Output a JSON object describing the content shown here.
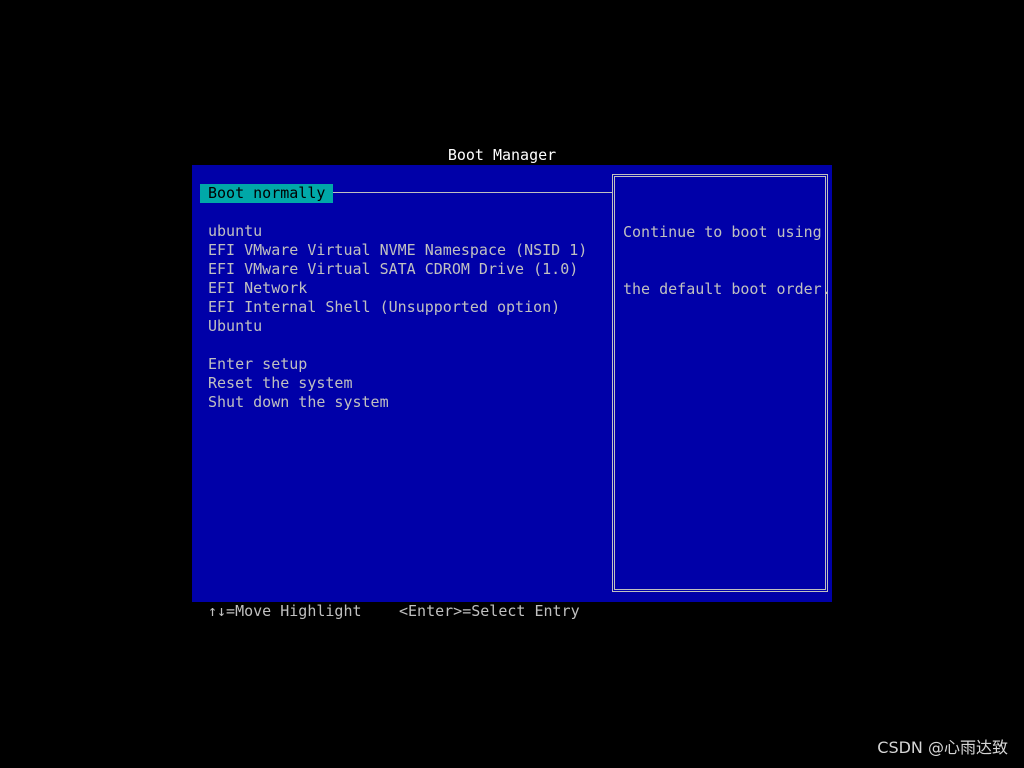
{
  "screen": {
    "title": "Boot Manager",
    "colors": {
      "background": "#000000",
      "panel": "#0000a8",
      "text": "#c0c0c0",
      "highlight_bg": "#00a8a8",
      "highlight_fg": "#000000",
      "title": "#ffffff"
    }
  },
  "menu": {
    "selected": "Boot normally",
    "boot_entries": [
      "ubuntu",
      "EFI VMware Virtual NVME Namespace (NSID 1)",
      "EFI VMware Virtual SATA CDROM Drive (1.0)",
      "EFI Network",
      "EFI Internal Shell (Unsupported option)",
      "Ubuntu"
    ],
    "system_entries": [
      "Enter setup",
      "Reset the system",
      "Shut down the system"
    ]
  },
  "help": {
    "line1": "Continue to boot using",
    "line2": "the default boot order."
  },
  "footer": {
    "move_hint": "↑↓=Move Highlight",
    "select_hint": "<Enter>=Select Entry"
  },
  "watermark": "CSDN @心雨达致"
}
